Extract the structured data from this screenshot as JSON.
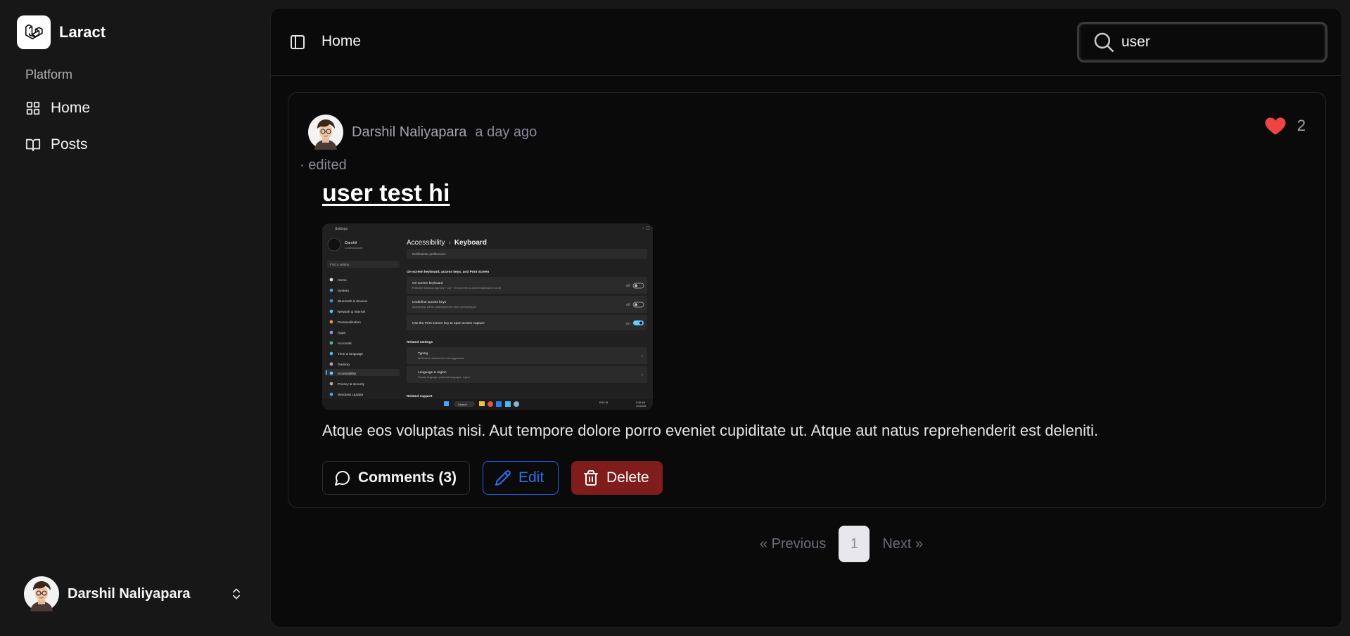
{
  "app": {
    "name": "Laract",
    "logo_icon": "laravel-logo-icon"
  },
  "sidebar": {
    "group_label": "Platform",
    "items": [
      {
        "label": "Home",
        "icon": "grid-icon"
      },
      {
        "label": "Posts",
        "icon": "book-open-icon"
      }
    ],
    "user": {
      "name": "Darshil Naliyapara",
      "icon": "chevrons-up-down-icon"
    }
  },
  "header": {
    "breadcrumb": "Home",
    "search": {
      "value": "user",
      "placeholder": ""
    }
  },
  "post": {
    "author": "Darshil Naliyapara",
    "time": "a day ago",
    "edited": "· edited",
    "likes": "2",
    "title": "user test hi",
    "body": "Atque eos voluptas nisi. Aut tempore dolore porro eveniet cupiditate ut. Atque aut natus reprehenderit est deleniti.",
    "comments_label": "Comments (3)",
    "edit_label": "Edit",
    "delete_label": "Delete",
    "image": {
      "window_title": "Settings",
      "account_name": "Darshil",
      "account_sub": "Local Account",
      "find_placeholder": "Find a setting",
      "nav": [
        "Home",
        "System",
        "Bluetooth & devices",
        "Network & internet",
        "Personalization",
        "Apps",
        "Accounts",
        "Time & language",
        "Gaming",
        "Accessibility",
        "Privacy & security",
        "Windows Update"
      ],
      "breadcrumb_parent": "Accessibility",
      "breadcrumb_sep": "›",
      "breadcrumb_current": "Keyboard",
      "top_row": "Notifications preferences",
      "section1": "On-screen keyboard, access keys, and Print screen",
      "rows1": [
        {
          "title": "On-screen keyboard",
          "sub": "Press the Windows logo key + Ctrl + O to turn the on-screen keyboard on or off",
          "state": "Off"
        },
        {
          "title": "Underline access keys",
          "sub": "Access keys will be underlined even when not holding Alt",
          "state": "Off"
        },
        {
          "title": "Use the Print screen key to open screen capture",
          "sub": "",
          "state": "On"
        }
      ],
      "section2": "Related settings",
      "rows2": [
        {
          "title": "Typing",
          "sub": "Spellcheck, autocorrect, text suggestions"
        },
        {
          "title": "Language & region",
          "sub": "Display language, preferred languages, region"
        }
      ],
      "section3": "Related support",
      "taskbar": {
        "search": "Search",
        "lang": "ENG IN",
        "time": "8:26 AM",
        "date": "1/1/2025"
      }
    }
  },
  "pagination": {
    "prev": "« Previous",
    "current": "1",
    "next": "Next »"
  },
  "colors": {
    "accent_blue": "#2563eb",
    "danger": "#7f1d1d",
    "heart": "#ef4444"
  }
}
